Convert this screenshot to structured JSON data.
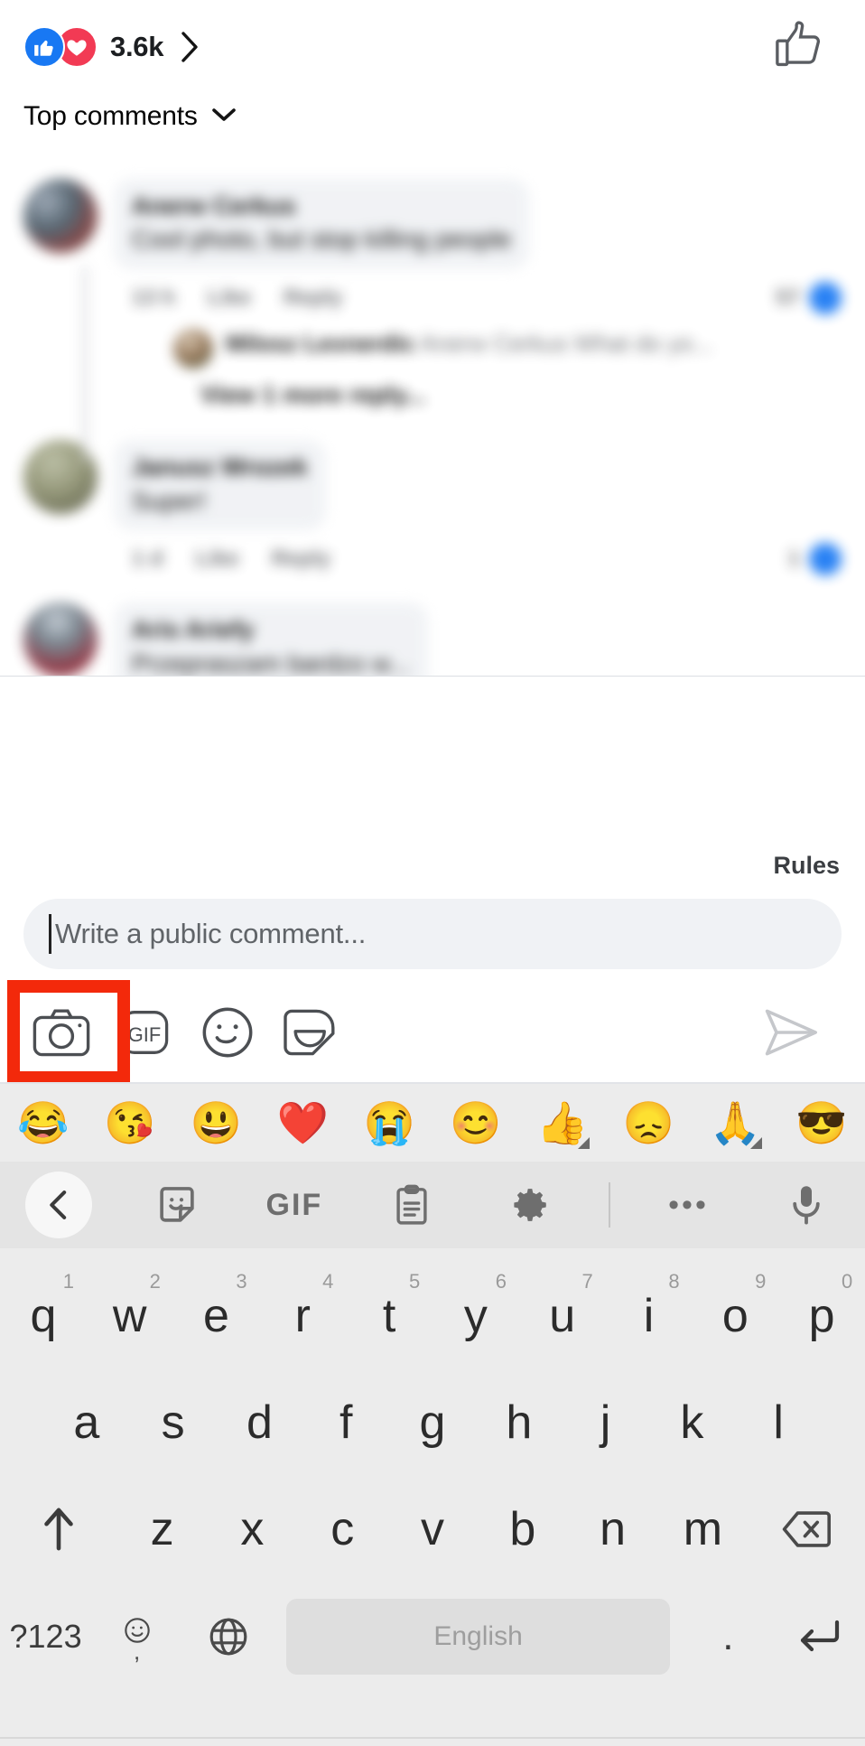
{
  "header": {
    "reactions": [
      {
        "name": "like-reaction",
        "color": "#1878f3"
      },
      {
        "name": "love-reaction",
        "color": "#f23a54"
      }
    ],
    "reaction_count": "3.6k",
    "chevron_icon": "chevron-right-icon",
    "thumb_icon": "thumbs-up-outline-icon"
  },
  "sort": {
    "label": "Top comments",
    "chevron_icon": "chevron-down-icon"
  },
  "comments": [
    {
      "author": "Anerw Cerkus",
      "text": "Cool photo, but stop killing people",
      "time": "13 h",
      "like_label": "Like",
      "reply_label": "Reply",
      "like_count": "57",
      "reply": {
        "author": "Milosz Lexnerdic",
        "text": "Anerw Cerkus What do yo...",
        "view_more": "View 1 more reply..."
      }
    },
    {
      "author": "Janusz Wrozek",
      "text": "Super!",
      "time": "1 d",
      "like_label": "Like",
      "reply_label": "Reply",
      "like_count": "1"
    },
    {
      "author": "Aris Ariefy",
      "text": "Przepraszam bardzo w..."
    }
  ],
  "rules": {
    "label": "Rules"
  },
  "composer": {
    "placeholder": "Write a public comment...",
    "value": "",
    "tools": [
      {
        "name": "camera-icon",
        "label": "Camera",
        "highlighted": true
      },
      {
        "name": "gif-icon",
        "label": "GIF",
        "highlighted": false
      },
      {
        "name": "emoji-smiley-icon",
        "label": "Emoji",
        "highlighted": false
      },
      {
        "name": "sticker-icon",
        "label": "Sticker",
        "highlighted": false
      }
    ],
    "send_icon": "send-paper-plane-icon",
    "highlight_color": "#f3290b"
  },
  "emoji_suggestions": [
    {
      "glyph": "😂",
      "name": "face-with-tears-of-joy",
      "variant": false
    },
    {
      "glyph": "😘",
      "name": "face-blowing-a-kiss",
      "variant": false
    },
    {
      "glyph": "😃",
      "name": "grinning-face-with-big-eyes",
      "variant": false
    },
    {
      "glyph": "❤️",
      "name": "red-heart",
      "variant": false
    },
    {
      "glyph": "😭",
      "name": "loudly-crying-face",
      "variant": false
    },
    {
      "glyph": "😊",
      "name": "smiling-face-with-smiling-eyes",
      "variant": false
    },
    {
      "glyph": "👍",
      "name": "thumbs-up",
      "variant": true
    },
    {
      "glyph": "😞",
      "name": "disappointed-face",
      "variant": false
    },
    {
      "glyph": "🙏",
      "name": "folded-hands",
      "variant": true
    },
    {
      "glyph": "😎",
      "name": "smiling-face-with-sunglasses",
      "variant": false
    }
  ],
  "keyboard": {
    "toolbar": [
      {
        "name": "back-chevron-icon",
        "label": ""
      },
      {
        "name": "sticker-icon",
        "label": ""
      },
      {
        "name": "gif-icon",
        "label": "GIF"
      },
      {
        "name": "clipboard-icon",
        "label": ""
      },
      {
        "name": "gear-icon",
        "label": ""
      },
      {
        "name": "divider",
        "label": ""
      },
      {
        "name": "more-options-icon",
        "label": "•••"
      },
      {
        "name": "microphone-icon",
        "label": ""
      }
    ],
    "row1": [
      {
        "letter": "q",
        "num": "1"
      },
      {
        "letter": "w",
        "num": "2"
      },
      {
        "letter": "e",
        "num": "3"
      },
      {
        "letter": "r",
        "num": "4"
      },
      {
        "letter": "t",
        "num": "5"
      },
      {
        "letter": "y",
        "num": "6"
      },
      {
        "letter": "u",
        "num": "7"
      },
      {
        "letter": "i",
        "num": "8"
      },
      {
        "letter": "o",
        "num": "9"
      },
      {
        "letter": "p",
        "num": "0"
      }
    ],
    "row2": [
      {
        "letter": "a"
      },
      {
        "letter": "s"
      },
      {
        "letter": "d"
      },
      {
        "letter": "f"
      },
      {
        "letter": "g"
      },
      {
        "letter": "h"
      },
      {
        "letter": "j"
      },
      {
        "letter": "k"
      },
      {
        "letter": "l"
      }
    ],
    "row3": [
      {
        "letter": "z"
      },
      {
        "letter": "x"
      },
      {
        "letter": "c"
      },
      {
        "letter": "v"
      },
      {
        "letter": "b"
      },
      {
        "letter": "n"
      },
      {
        "letter": "m"
      }
    ],
    "shift_icon": "shift-arrow-up-icon",
    "backspace_icon": "backspace-icon",
    "symbols_key": "?123",
    "emoji_key": "emoji-comma-icon",
    "globe_key": "globe-language-icon",
    "space_label": "English",
    "period_key": ".",
    "enter_icon": "enter-return-icon"
  }
}
